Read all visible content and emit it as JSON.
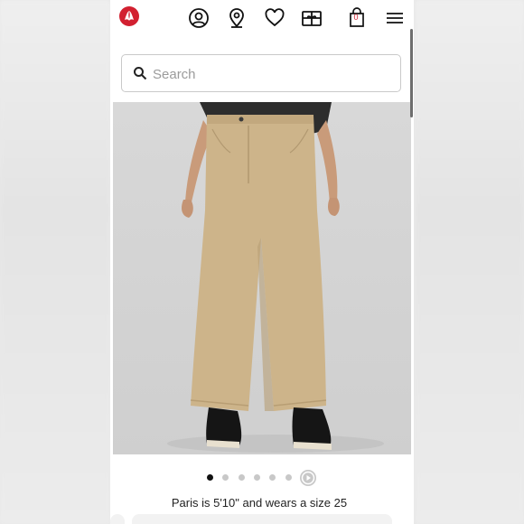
{
  "header": {
    "logo": "lululemon-logo-icon",
    "icons": [
      "account-icon",
      "store-locator-icon",
      "wishlist-heart-icon",
      "gift-card-icon",
      "shopping-bag-icon",
      "menu-icon"
    ],
    "bag_count": "0",
    "brand_color": "#d22030"
  },
  "search": {
    "placeholder": "Search",
    "value": ""
  },
  "product": {
    "image": "product-photo-khaki-wide-leg-pants",
    "pants_color": "#cdb48a",
    "gallery_total_dots": 7,
    "gallery_active_index": 0,
    "model_caption": "Paris is 5'10\" and wears a size 25"
  }
}
